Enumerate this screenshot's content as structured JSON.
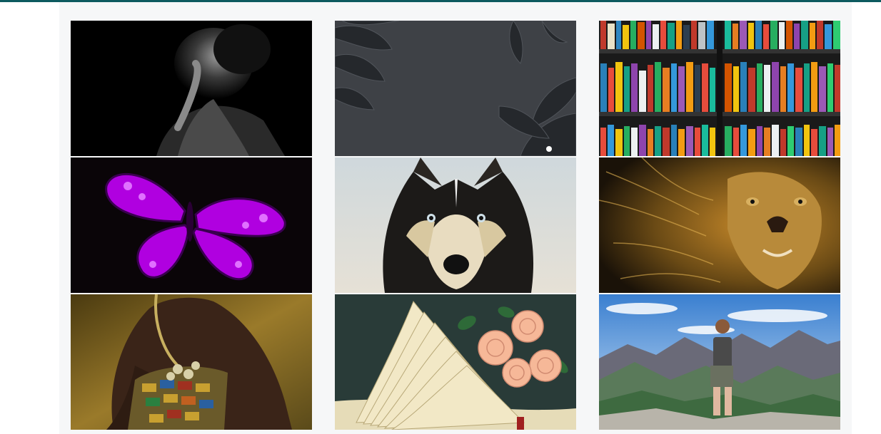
{
  "colors": {
    "accent": "#0d5a5f",
    "panel_bg": "#f6f7f8"
  },
  "gallery": {
    "images": [
      {
        "subject": "woman-portrait-bw"
      },
      {
        "subject": "dark-leaves"
      },
      {
        "subject": "bookshelf"
      },
      {
        "subject": "purple-butterfly"
      },
      {
        "subject": "husky-dog"
      },
      {
        "subject": "lion"
      },
      {
        "subject": "woman-golden-dress"
      },
      {
        "subject": "book-roses"
      },
      {
        "subject": "hiker-mountains"
      }
    ]
  }
}
